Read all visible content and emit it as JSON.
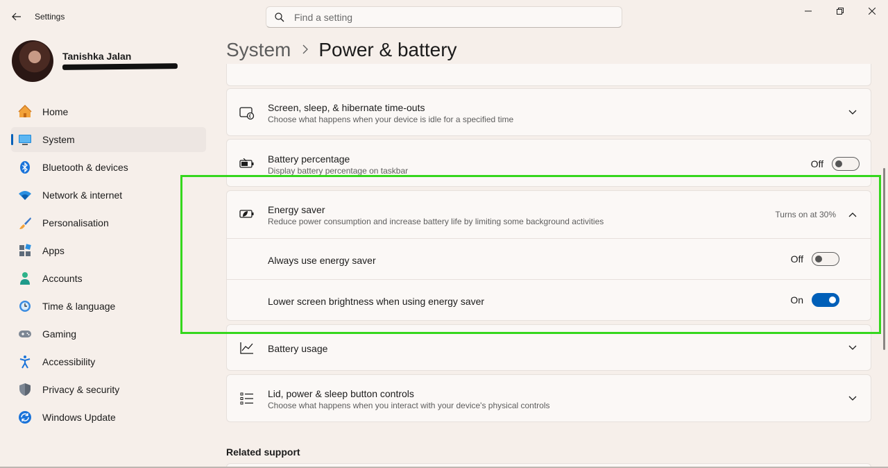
{
  "app": {
    "title": "Settings"
  },
  "search": {
    "placeholder": "Find a setting"
  },
  "profile": {
    "name": "Tanishka Jalan"
  },
  "sidebar": {
    "items": [
      {
        "label": "Home",
        "icon": "home-icon"
      },
      {
        "label": "System",
        "icon": "system-icon"
      },
      {
        "label": "Bluetooth & devices",
        "icon": "bluetooth-icon"
      },
      {
        "label": "Network & internet",
        "icon": "network-icon"
      },
      {
        "label": "Personalisation",
        "icon": "brush-icon"
      },
      {
        "label": "Apps",
        "icon": "apps-icon"
      },
      {
        "label": "Accounts",
        "icon": "accounts-icon"
      },
      {
        "label": "Time & language",
        "icon": "time-language-icon"
      },
      {
        "label": "Gaming",
        "icon": "gaming-icon"
      },
      {
        "label": "Accessibility",
        "icon": "accessibility-icon"
      },
      {
        "label": "Privacy & security",
        "icon": "shield-icon"
      },
      {
        "label": "Windows Update",
        "icon": "update-icon"
      }
    ]
  },
  "breadcrumb": {
    "parent": "System",
    "current": "Power & battery"
  },
  "cards": {
    "screen_sleep": {
      "title": "Screen, sleep, & hibernate time-outs",
      "subtitle": "Choose what happens when your device is idle for a specified time"
    },
    "battery_percentage": {
      "title": "Battery percentage",
      "subtitle": "Display battery percentage on taskbar",
      "state": "Off"
    },
    "energy_saver": {
      "title": "Energy saver",
      "subtitle": "Reduce power consumption and increase battery life by limiting some background activities",
      "note": "Turns on at 30%",
      "always_use": {
        "label": "Always use energy saver",
        "state": "Off"
      },
      "lower_brightness": {
        "label": "Lower screen brightness when using energy saver",
        "state": "On"
      }
    },
    "battery_usage": {
      "title": "Battery usage"
    },
    "lid_power": {
      "title": "Lid, power & sleep button controls",
      "subtitle": "Choose what happens when you interact with your device's physical controls"
    }
  },
  "related": {
    "title": "Related support"
  },
  "colors": {
    "accent": "#005fb8",
    "highlight": "#35d71d",
    "background": "#f6efea"
  }
}
